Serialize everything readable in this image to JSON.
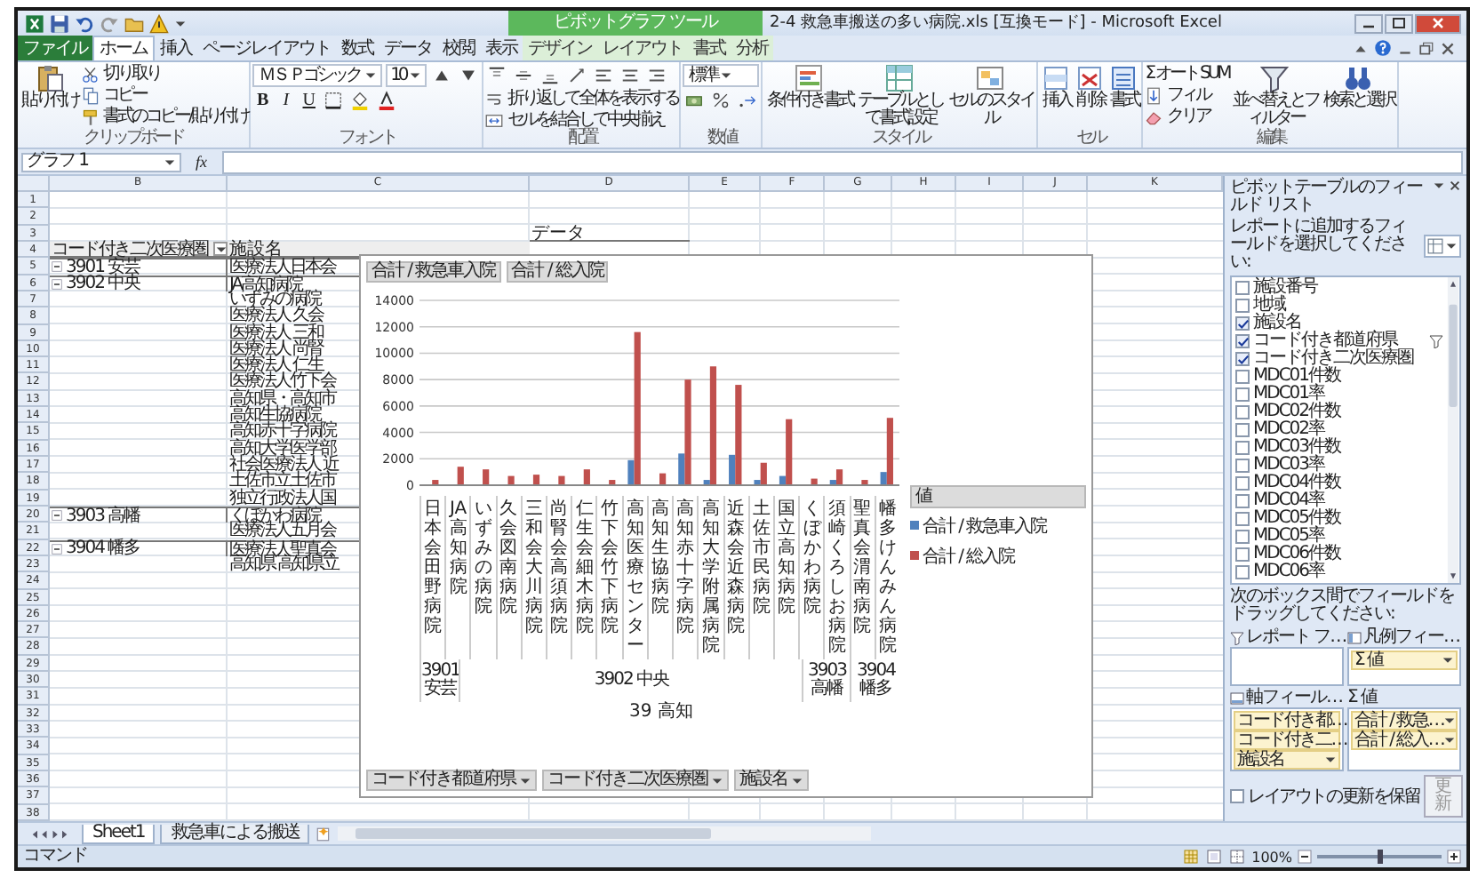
{
  "window": {
    "title": "2-4 救急車搬送の多い病院.xls [互換モード] - Microsoft Excel",
    "context_tab_group": "ピボットグラフ ツール"
  },
  "tabs": [
    {
      "label": "ファイル",
      "kind": "file",
      "selected": false
    },
    {
      "label": "ホーム",
      "kind": "normal",
      "selected": true
    },
    {
      "label": "挿入",
      "kind": "normal",
      "selected": false
    },
    {
      "label": "ページレイアウト",
      "kind": "normal",
      "selected": false
    },
    {
      "label": "数式",
      "kind": "normal",
      "selected": false
    },
    {
      "label": "データ",
      "kind": "normal",
      "selected": false
    },
    {
      "label": "校閲",
      "kind": "normal",
      "selected": false
    },
    {
      "label": "表示",
      "kind": "normal",
      "selected": false
    },
    {
      "label": "デザイン",
      "kind": "context",
      "selected": false
    },
    {
      "label": "レイアウト",
      "kind": "context",
      "selected": false
    },
    {
      "label": "書式",
      "kind": "context",
      "selected": false
    },
    {
      "label": "分析",
      "kind": "context",
      "selected": false
    }
  ],
  "ribbon": {
    "groups": [
      {
        "label": "クリップボード",
        "columns": [
          [
            {
              "kind": "large",
              "label": "貼り付け"
            }
          ],
          [
            {
              "kind": "small",
              "label": "切り取り"
            },
            {
              "kind": "small",
              "label": "コピー"
            },
            {
              "kind": "small",
              "label": "書式のコピー/貼り付け"
            }
          ]
        ]
      },
      {
        "label": "フォント",
        "columns": [
          [
            {
              "kind": "row",
              "items": [
                {
                  "kind": "select",
                  "value": "ＭＳ Ｐゴシック"
                },
                {
                  "kind": "select",
                  "value": "10"
                },
                {
                  "kind": "icon"
                },
                {
                  "kind": "icon"
                }
              ]
            },
            {
              "kind": "row",
              "items": [
                {
                  "kind": "bold",
                  "label": "B"
                },
                {
                  "kind": "italic",
                  "label": "I"
                },
                {
                  "kind": "underline",
                  "label": "U"
                },
                {
                  "kind": "icon"
                },
                {
                  "kind": "icon"
                },
                {
                  "kind": "icon"
                }
              ]
            }
          ]
        ]
      },
      {
        "label": "配置",
        "columns": [
          [
            {
              "kind": "row",
              "items": [
                {
                  "kind": "icon"
                },
                {
                  "kind": "icon"
                },
                {
                  "kind": "icon"
                },
                {
                  "kind": "icon"
                },
                {
                  "kind": "icon"
                },
                {
                  "kind": "icon"
                },
                {
                  "kind": "icon"
                }
              ]
            },
            {
              "kind": "small",
              "label": "折り返して全体を表示する"
            },
            {
              "kind": "small",
              "label": "セルを結合して中央揃え"
            }
          ]
        ]
      },
      {
        "label": "数値",
        "columns": [
          [
            {
              "kind": "select",
              "value": "標準"
            },
            {
              "kind": "row",
              "items": [
                {
                  "kind": "icon"
                },
                {
                  "kind": "icon"
                },
                {
                  "kind": "icon"
                }
              ]
            }
          ]
        ]
      },
      {
        "label": "スタイル",
        "columns": [
          [
            {
              "kind": "large",
              "label": "条件付き書式"
            }
          ],
          [
            {
              "kind": "large",
              "label": "テーブルとして書式設定"
            }
          ],
          [
            {
              "kind": "large",
              "label": "セルのスタイル"
            }
          ]
        ]
      },
      {
        "label": "セル",
        "columns": [
          [
            {
              "kind": "large",
              "label": "挿入"
            }
          ],
          [
            {
              "kind": "large",
              "label": "削除"
            }
          ],
          [
            {
              "kind": "large",
              "label": "書式"
            }
          ]
        ]
      },
      {
        "label": "編集",
        "columns": [
          [
            {
              "kind": "small",
              "label": "Σ オート SUM"
            },
            {
              "kind": "small",
              "label": "フィル"
            },
            {
              "kind": "small",
              "label": "クリア"
            }
          ],
          [
            {
              "kind": "large",
              "label": "並べ替えとフィルター"
            }
          ],
          [
            {
              "kind": "large",
              "label": "検索と選択"
            }
          ]
        ]
      }
    ]
  },
  "formula_bar": {
    "name_box": "グラフ 1",
    "function_label": "fx"
  },
  "sheet": {
    "columns": [
      "B",
      "C",
      "D",
      "E",
      "F",
      "G",
      "H",
      "I",
      "J",
      "K"
    ],
    "row_numbers": [
      "1",
      "2",
      "3",
      "4",
      "5",
      "6",
      "7",
      "8",
      "9",
      "10",
      "11",
      "12",
      "13",
      "14",
      "15",
      "16",
      "17",
      "18",
      "19",
      "20",
      "21",
      "22",
      "23",
      "24",
      "25",
      "26",
      "27",
      "28",
      "29",
      "30",
      "31",
      "32",
      "33",
      "34",
      "35",
      "36",
      "37",
      "38"
    ],
    "data_header": "データ",
    "pivot": {
      "row_field": "コード付き二次医療圏",
      "value_header": "施設名",
      "groups": [
        {
          "label": "3901 安芸",
          "rows": [
            "医療法人日本会"
          ]
        },
        {
          "label": "3902 中央",
          "rows": [
            "JA高知病院",
            "いずみの病院",
            "医療法人 久会",
            "医療法人 三和",
            "医療法人 尚腎",
            "医療法人 仁生",
            "医療法人竹下会",
            "高知県・高知市",
            "高知生協病院",
            "高知赤十字病院",
            "高知大学医学部",
            "社会医療法人 近",
            "土佐市立土佐市",
            "独立行政法人国"
          ]
        },
        {
          "label": "3903 高幡",
          "rows": [
            "くぼかわ病院",
            "医療法人五月会"
          ]
        },
        {
          "label": "3904 幡多",
          "rows": [
            "医療法人聖真会",
            "高知県 高知県立"
          ]
        }
      ]
    }
  },
  "chart": {
    "value_buttons": [
      "合計 / 救急車入院",
      "合計 / 総入院"
    ],
    "axis_buttons": [
      "コード付き都道府県",
      "コード付き二次医療圏",
      "施設名"
    ],
    "legend_title": "値",
    "axis_groups": [
      "3901 安芸",
      "3902 中央",
      "3903 高幡",
      "3904 幡多"
    ],
    "chart_data": {
      "type": "bar",
      "xlabel": "39 高知",
      "categories": [
        "日本会田野病院",
        "JA高知病院",
        "いずみの病院",
        "久会図南病院",
        "三和会大川病院",
        "尚腎会高須病院",
        "仁生会細木病院",
        "竹下会竹下病院",
        "高知医療センター",
        "高知生協病院",
        "高知赤十字病院",
        "高知大学附属病院",
        "近森会近森病院",
        "土佐市民病院",
        "国立高知病院",
        "くぼかわ病院",
        "須崎くろしお病院",
        "聖真会渭南病院",
        "幡多けんみん病院"
      ],
      "series": [
        {
          "name": "合計 / 救急車入院",
          "color": "#4f81bd",
          "values": [
            0,
            0,
            null,
            0,
            0,
            0,
            0,
            0,
            1900,
            0,
            2400,
            400,
            2300,
            400,
            700,
            null,
            400,
            null,
            1000
          ]
        },
        {
          "name": "合計 / 総入院",
          "color": "#c0504d",
          "values": [
            400,
            1400,
            1200,
            700,
            800,
            700,
            1200,
            400,
            11600,
            900,
            8000,
            9000,
            7600,
            1700,
            5000,
            500,
            1200,
            400,
            5100
          ]
        }
      ],
      "grid": true,
      "legend": "right",
      "ylim": [
        0,
        14000
      ],
      "yticks": [
        0,
        2000,
        4000,
        6000,
        8000,
        10000,
        12000,
        14000
      ]
    }
  },
  "field_list": {
    "title": "ピボットテーブルのフィールド リスト",
    "prompt": "レポートに追加するフィールドを選択してください:",
    "fields": [
      {
        "label": "施設番号",
        "checked": false,
        "filtered": false
      },
      {
        "label": "地域",
        "checked": false,
        "filtered": false
      },
      {
        "label": "施設名",
        "checked": true,
        "filtered": false
      },
      {
        "label": "コード付き都道府県",
        "checked": true,
        "filtered": true
      },
      {
        "label": "コード付き二次医療圏",
        "checked": true,
        "filtered": false
      },
      {
        "label": "MDC01件数",
        "checked": false,
        "filtered": false
      },
      {
        "label": "MDC01率",
        "checked": false,
        "filtered": false
      },
      {
        "label": "MDC02件数",
        "checked": false,
        "filtered": false
      },
      {
        "label": "MDC02率",
        "checked": false,
        "filtered": false
      },
      {
        "label": "MDC03件数",
        "checked": false,
        "filtered": false
      },
      {
        "label": "MDC03率",
        "checked": false,
        "filtered": false
      },
      {
        "label": "MDC04件数",
        "checked": false,
        "filtered": false
      },
      {
        "label": "MDC04率",
        "checked": false,
        "filtered": false
      },
      {
        "label": "MDC05件数",
        "checked": false,
        "filtered": false
      },
      {
        "label": "MDC05率",
        "checked": false,
        "filtered": false
      },
      {
        "label": "MDC06件数",
        "checked": false,
        "filtered": false
      },
      {
        "label": "MDC06率",
        "checked": false,
        "filtered": false
      }
    ],
    "instruction": "次のボックス間でフィールドをドラッグしてください:",
    "areas": [
      {
        "label": "レポート フ…"
      },
      {
        "label": "凡例フィー…",
        "items": [
          "Σ 値"
        ]
      },
      {
        "label": "軸フィール…",
        "items": [
          "コード付き都…",
          "コード付き二…",
          "施設名"
        ]
      },
      {
        "label": "Σ 値",
        "items": [
          "合計 / 救急…",
          "合計 / 総入…"
        ]
      }
    ],
    "defer": {
      "label": "レイアウトの更新を保留",
      "checked": false
    },
    "update_button": {
      "label": "更新",
      "disabled": true
    }
  },
  "sheet_tabs": [
    {
      "label": "Sheet1",
      "selected": true
    },
    {
      "label": "救急車による搬送",
      "selected": false
    }
  ],
  "status_bar": {
    "mode": "コマンド",
    "zoom": "100%",
    "zoom_slider": {
      "level": 0.5
    }
  }
}
